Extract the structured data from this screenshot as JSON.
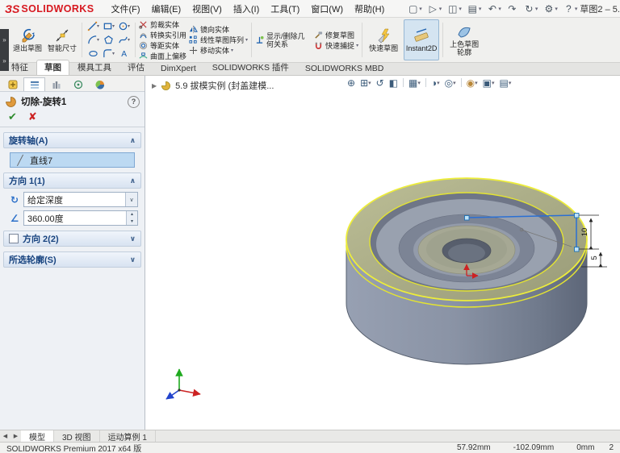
{
  "icons": {
    "caret": "▾",
    "chev_up": "∧",
    "chev_down": "∨",
    "check": "✔",
    "cross": "✘",
    "help": "?",
    "flyout": "»",
    "breadcrumb_arrow": "▶",
    "tab_prev": "◀",
    "tab_next": "▶",
    "spin_up": "▴",
    "spin_down": "▾",
    "revolve_dir": "↻",
    "angle": "∠",
    "axis": "╱",
    "hud": {
      "zoom_fit": "⊕",
      "zoom_area": "⊞",
      "prev_view": "↺",
      "section_view": "◧",
      "view_orientation": "▦",
      "display_style": "◑",
      "hide_show": "◎",
      "appearance": "◉",
      "scene": "▣",
      "view_settings": "▤"
    },
    "title_icons": {
      "new": "▢",
      "open": "▷",
      "save": "◫",
      "print": "▤",
      "undo": "↶",
      "redo": "↷",
      "rebuild": "↻",
      "options": "⚙",
      "help": "?"
    }
  },
  "titlebar": {
    "logo_mark": "ЗS",
    "logo": "SOLIDWORKS",
    "menus": [
      "文件(F)",
      "编辑(E)",
      "视图(V)",
      "插入(I)",
      "工具(T)",
      "窗口(W)",
      "帮助(H)"
    ],
    "doc_title": "草图2 – 5..."
  },
  "ribbon": {
    "exit_sketch": "退出草图",
    "smart_dimension": "智能尺寸",
    "col1": [
      "剪裁实体",
      "转换实引用",
      "等距实体",
      "曲面上偏移"
    ],
    "col2": [
      "镜向实体",
      "线性草图阵列",
      "移动实体"
    ],
    "relations": "显示/删除几何关系",
    "repair_sketch": "修复草图",
    "quick_snaps": "快速捕捉",
    "rapid_sketch": "快速草图",
    "instant2d": "Instant2D",
    "shaded_contours": "上色草图轮廓"
  },
  "tabs": [
    "特征",
    "草图",
    "模具工具",
    "评估",
    "DimXpert",
    "SOLIDWORKS 插件",
    "SOLIDWORKS MBD"
  ],
  "pm": {
    "title": "切除-旋转1",
    "axis_label": "旋转轴(A)",
    "axis_value": "直线7",
    "dir1_label": "方向 1(1)",
    "end_condition": "给定深度",
    "angle": "360.00度",
    "dir2_label": "方向 2(2)",
    "contours_label": "所选轮廓(S)"
  },
  "viewport": {
    "breadcrumb": "5.9 拔模实例 (封盖建模...",
    "dim_10": "10",
    "dim_5": "5"
  },
  "bottom_tabs": [
    "模型",
    "3D 视图",
    "运动算例 1"
  ],
  "statusbar": {
    "product": "SOLIDWORKS Premium 2017 x64 版",
    "x": "57.92mm",
    "y": "-102.09mm",
    "z": "0mm",
    "fragment": "2"
  }
}
